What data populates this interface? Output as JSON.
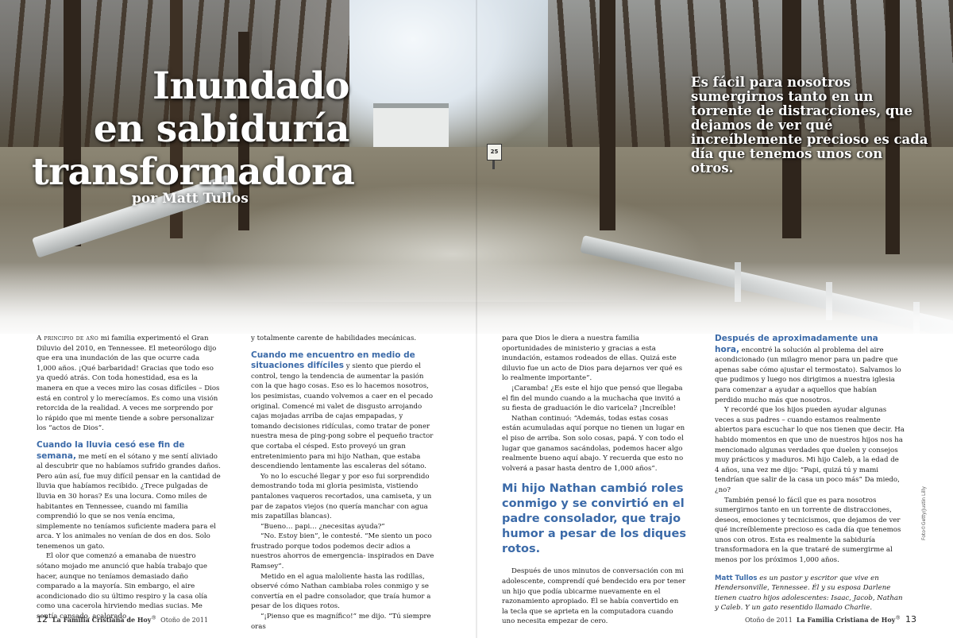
{
  "title_lines": [
    "Inundado",
    "en sabiduría",
    "transformadora"
  ],
  "byline": "por Matt Tullos",
  "pullquote": "Es fácil para nosotros sumergirnos tanto en un torrente de distracciones, que dejamos de ver qué increíblemente precioso es cada día que tenemos unos con otros.",
  "photo": {
    "credit": "Foto©Getty/Justin Lilly",
    "sign_text": "25"
  },
  "col1": {
    "lead_in": "A principio de año",
    "p1": " mi familia experimentó el Gran Diluvio del 2010, en Tennessee. El meteorólogo dijo que era una inundación de las que ocurre cada 1,000 años. ¡Qué barbaridad! Gracias que todo eso ya quedó atrás. Con toda honestidad, esa es la manera en que a veces miro las cosas difíciles – Dios está en control y lo merecíamos. Es como una visión retorcida de la realidad. A veces me sorprendo por lo rápido que mi mente tiende a sobre personalizar los “actos de Dios”.",
    "sub1": "Cuando la lluvia cesó ese fin de semana,",
    "p2": " me metí en el sótano y me sentí aliviado al descubrir que no habíamos sufrido grandes daños. Pero aún así, fue muy difícil pensar en la cantidad de lluvia que habíamos recibido. ¿Trece pulgadas de lluvia en 30 horas? Es una locura. Como miles de habitantes en Tennessee, cuando mi familia comprendió lo que se nos venía encima, simplemente no teníamos suficiente madera para el arca. Y los animales no venían de dos en dos. Solo tenemenos un gato.",
    "p3": "El olor que comenzó a emanaba de nuestro sótano mojado me anunció que había trabajo que hacer, aunque no teníamos demasiado daño comparado a la mayoría. Sin embargo, el aire acondicionado dio su último respiro y la casa olía como una cacerola hirviendo medias sucias. Me sentía cansado, acalorado"
  },
  "col2": {
    "p0": "y totalmente carente de habilidades mecánicas.",
    "sub2": "Cuando me encuentro en medio de situaciones difíciles",
    "p1": " y siento que pierdo el control, tengo la tendencia de aumentar la pasión con la que hago cosas. Eso es lo hacemos nosotros, los pesimistas, cuando volvemos a caer en el pecado original. Comencé mi valet de disgusto arrojando cajas mojadas arriba de cajas empapadas, y tomando decisiones ridículas, como tratar de poner nuestra mesa de ping-pong sobre el pequeño tractor que cortaba el césped. Esto proveyó un gran entretenimiento para mi hijo Nathan, que estaba descendiendo lentamente las escaleras del sótano.",
    "p2": "Yo no lo escuché llegar y por eso fui sorprendido demostrando toda mi gloria pesimista, vistiendo pantalones vaqueros recortados, una camiseta, y un par de zapatos viejos (no quería manchar con agua mis zapatillas blancas).",
    "p3": "“Bueno… papi… ¿necesitas ayuda?”",
    "p4": "“No. Estoy bien”, le contesté. “Me siento un poco frustrado porque todos podemos decir adios a nuestros ahorros de emergencia- inspirados en Dave Ramsey”.",
    "p5": "Metido en el agua maloliente hasta las rodillas, observé cómo Nathan cambiaba roles conmigo y se convertía en el padre consolador, que traía humor a pesar de los diques rotos.",
    "p6": "“¡Pienso que es magnífico!” me dijo. “Tú siempre oras"
  },
  "col3": {
    "p0": "para que Dios le diera a nuestra familia oportunidades de ministerio y gracias a esta inundación, estamos rodeados de ellas. Quizá este diluvio fue un acto de Dios para dejarnos ver qué es lo realmente importante”.",
    "p1": "¡Caramba! ¿Es este el hijo que pensó que llegaba el fin del mundo cuando a la muchacha que invitó a su fiesta de graduación le dio varicela? ¡Increíble!",
    "p2": "Nathan continuó: “Además, todas estas cosas están acumuladas aquí porque no tienen un lugar en el piso de arriba. Son solo cosas, papá. Y con todo el lugar que ganamos sacándolas, podemos hacer algo realmente bueno aquí abajo. Y recuerda que esto no volverá a pasar hasta dentro de 1,000 años”.",
    "quote": "Mi hijo Nathan cambió roles conmigo y se convirtió en el padre consolador, que trajo humor a pesar de los diques rotos.",
    "p3": "Después de unos minutos de conversación con mi adolescente, comprendí qué bendecido era por tener un hijo que podía ubicarme nuevamente en el razonamiento apropiado. Él se había convertido en la tecla que se aprieta en la computadora cuando uno necesita empezar de cero."
  },
  "col4": {
    "sub3": "Después de aproximadamente una hora,",
    "p1": " encontré la solución al problema del aire acondicionado (un milagro menor para un padre que apenas sabe cómo ajustar el termostato). Salvamos lo que pudimos y luego nos dirigimos a nuestra iglesia para comenzar a ayudar a aquellos que habían perdido mucho más que nosotros.",
    "p2": "Y recordé que los hijos pueden ayudar algunas veces a sus padres – cuando estamos realmente abiertos para escuchar lo que nos tienen que decir. Ha habido momentos en que uno de nuestros hijos nos ha mencionado algunas verdades que duelen y consejos muy prácticos y maduros. Mi hijo Caleb, a la edad de 4 años, una vez me dijo: “Papi, quizá tú y mami tendrían que salir de la casa un poco más” Da miedo, ¿no?",
    "p3": "También pensé lo fácil que es para nosotros sumergirnos tanto en un torrente de distracciones, deseos, emociones y tecnicismos, que dejamos de ver qué increíblemente precioso es cada día que tenemos unos con otros. Esta es realmente la sabiduría transformadora en la que trataré de sumergirme al menos por los próximos 1,000 años.",
    "bio_name": "Matt Tullos",
    "bio_text": " es un pastor y escritor que vive en Hendersonville, Tennessee. Él y su esposa Darlene tienen cuatro hijos adolescentes: Isaac, Jacob, Nathan y Caleb. Y un gato resentido llamado Charlie."
  },
  "footer_left": {
    "page": "12",
    "magazine": "La Familia Cristiana de Hoy",
    "reg": "®",
    "issue": "Otoño de 2011"
  },
  "footer_right": {
    "issue": "Otoño de 2011",
    "magazine": "La Familia Cristiana de Hoy",
    "reg": "®",
    "page": "13"
  }
}
